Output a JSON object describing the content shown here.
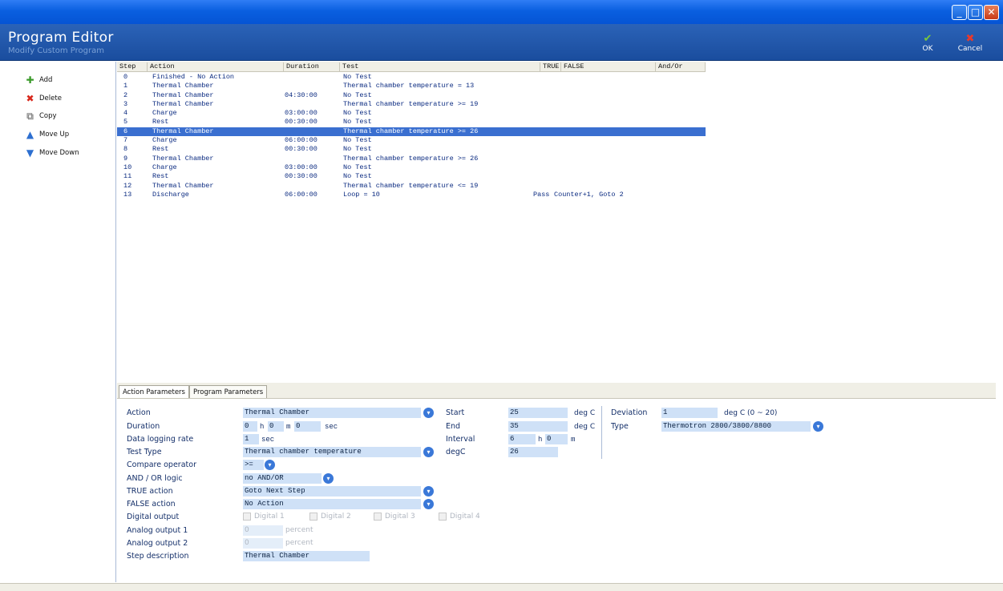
{
  "window": {
    "minimize": "_",
    "maximize": "□",
    "close": "✕"
  },
  "header": {
    "title": "Program Editor",
    "subtitle": "Modify Custom Program",
    "ok_label": "OK",
    "cancel_label": "Cancel"
  },
  "sidebar": {
    "items": [
      {
        "label": "Add",
        "icon": "add-icon",
        "glyph": "✚",
        "color": "#3a9a2a"
      },
      {
        "label": "Delete",
        "icon": "delete-icon",
        "glyph": "✖",
        "color": "#d8281c"
      },
      {
        "label": "Copy",
        "icon": "copy-icon",
        "glyph": "⧉",
        "color": "#8a8a8a"
      },
      {
        "label": "Move Up",
        "icon": "arrow-up-icon",
        "glyph": "▲",
        "color": "#2d6fd0"
      },
      {
        "label": "Move Down",
        "icon": "arrow-down-icon",
        "glyph": "▼",
        "color": "#2d6fd0"
      }
    ]
  },
  "table": {
    "columns": [
      "Step",
      "Action",
      "Duration",
      "Test",
      "TRUE",
      "FALSE",
      "And/Or"
    ],
    "selected_index": 6,
    "rows": [
      {
        "step": "0",
        "action": "Finished - No Action",
        "duration": "",
        "test": "No Test",
        "true_action": "",
        "false_action": ""
      },
      {
        "step": "1",
        "action": "Thermal Chamber",
        "duration": "",
        "test": "Thermal chamber temperature = 13",
        "true_action": "",
        "false_action": ""
      },
      {
        "step": "2",
        "action": "Thermal Chamber",
        "duration": "04:30:00",
        "test": "No Test",
        "true_action": "",
        "false_action": ""
      },
      {
        "step": "3",
        "action": "Thermal Chamber",
        "duration": "",
        "test": "Thermal chamber temperature >= 19",
        "true_action": "",
        "false_action": ""
      },
      {
        "step": "4",
        "action": "Charge",
        "duration": "03:00:00",
        "test": "No Test",
        "true_action": "",
        "false_action": ""
      },
      {
        "step": "5",
        "action": "Rest",
        "duration": "00:30:00",
        "test": "No Test",
        "true_action": "",
        "false_action": ""
      },
      {
        "step": "6",
        "action": "Thermal Chamber",
        "duration": "",
        "test": "Thermal chamber temperature >= 26",
        "true_action": "",
        "false_action": ""
      },
      {
        "step": "7",
        "action": "Charge",
        "duration": "06:00:00",
        "test": "No Test",
        "true_action": "",
        "false_action": ""
      },
      {
        "step": "8",
        "action": "Rest",
        "duration": "00:30:00",
        "test": "No Test",
        "true_action": "",
        "false_action": ""
      },
      {
        "step": "9",
        "action": "Thermal Chamber",
        "duration": "",
        "test": "Thermal chamber temperature >= 26",
        "true_action": "",
        "false_action": ""
      },
      {
        "step": "10",
        "action": "Charge",
        "duration": "03:00:00",
        "test": "No Test",
        "true_action": "",
        "false_action": ""
      },
      {
        "step": "11",
        "action": "Rest",
        "duration": "00:30:00",
        "test": "No Test",
        "true_action": "",
        "false_action": ""
      },
      {
        "step": "12",
        "action": "Thermal Chamber",
        "duration": "",
        "test": "Thermal chamber temperature <= 19",
        "true_action": "",
        "false_action": ""
      },
      {
        "step": "13",
        "action": "Discharge",
        "duration": "06:00:00",
        "test": "Loop = 10",
        "true_action": "Pass",
        "false_action": "Counter+1, Goto 2"
      }
    ]
  },
  "tabs": [
    "Action Parameters",
    "Program Parameters"
  ],
  "params": {
    "labels": {
      "action": "Action",
      "duration": "Duration",
      "logging": "Data logging rate",
      "test_type": "Test Type",
      "compare": "Compare operator",
      "andor": "AND / OR logic",
      "true_action": "TRUE action",
      "false_action": "FALSE action",
      "digital": "Digital output",
      "analog1": "Analog output 1",
      "analog2": "Analog output 2",
      "description": "Step description",
      "start": "Start",
      "end": "End",
      "interval": "Interval",
      "degc": "degC",
      "deviation": "Deviation",
      "type": "Type"
    },
    "values": {
      "action": "Thermal Chamber",
      "dur_h": "0",
      "dur_m": "0",
      "dur_s": "0",
      "logging": "1",
      "test_type": "Thermal chamber temperature",
      "compare": ">=",
      "andor": "no AND/OR",
      "true_action": "Goto Next Step",
      "false_action": "No Action",
      "analog1": "0",
      "analog2": "0",
      "description": "Thermal Chamber",
      "start": "25",
      "end": "35",
      "interval_h": "6",
      "interval_m": "0",
      "degc": "26",
      "deviation": "1",
      "type": "Thermotron 2800/3800/8800"
    },
    "units": {
      "h": "h",
      "m": "m",
      "sec": "sec",
      "degc": "deg C",
      "deviation_range": "deg C (0 ~ 20)",
      "percent": "percent"
    },
    "digital_outputs": [
      "Digital 1",
      "Digital 2",
      "Digital 3",
      "Digital 4"
    ]
  }
}
